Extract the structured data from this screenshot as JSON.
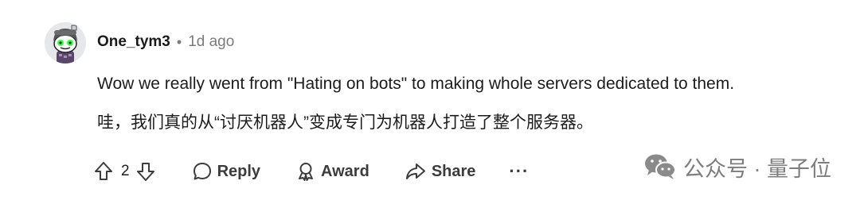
{
  "comment": {
    "author": "One_tym3",
    "separator": "•",
    "time_ago": "1d ago",
    "body_en": "Wow we really went from \"Hating on bots\" to making whole servers dedicated to them.",
    "body_zh": "哇，我们真的从“讨厌机器人”变成专门为机器人打造了整个服务器。"
  },
  "actions": {
    "vote_count": "2",
    "reply_label": "Reply",
    "award_label": "Award",
    "share_label": "Share",
    "more_label": "···"
  },
  "icons": {
    "avatar": "snoo-avatar-icon",
    "upvote": "upvote-arrow-icon",
    "downvote": "downvote-arrow-icon",
    "reply": "speech-bubble-icon",
    "award": "award-ribbon-icon",
    "share": "share-arrow-icon",
    "wechat": "wechat-logo-icon"
  },
  "watermark": {
    "text": "公众号 · 量子位"
  },
  "colors": {
    "text": "#1a1a1b",
    "muted": "#7c7c7c",
    "action": "#3c3c3c",
    "watermark": "#7d7d7d"
  }
}
